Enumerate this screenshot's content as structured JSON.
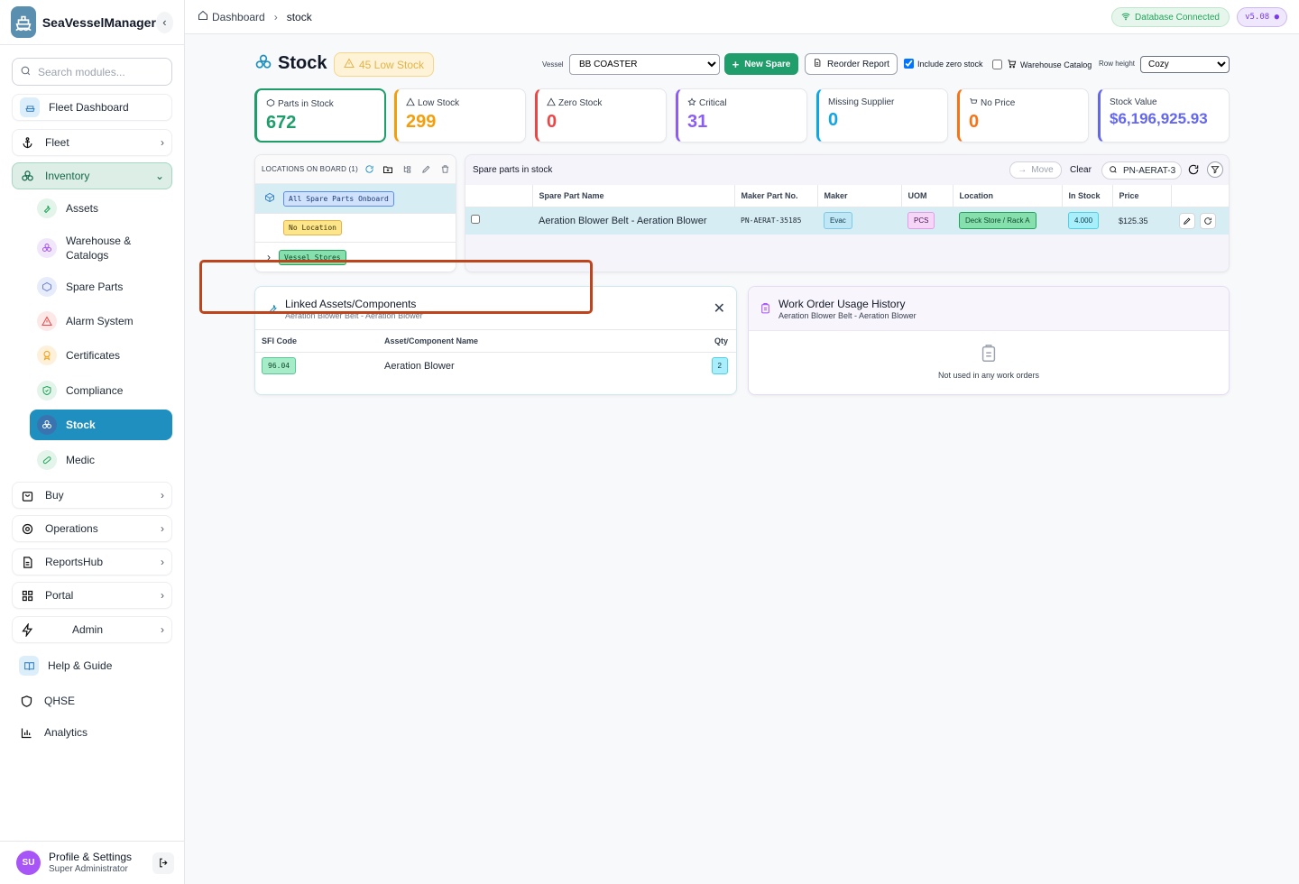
{
  "app": {
    "name": "SeaVesselManager"
  },
  "sidebar": {
    "search_placeholder": "Search modules...",
    "items": {
      "fleet_dashboard": "Fleet Dashboard",
      "fleet": "Fleet",
      "inventory": "Inventory",
      "buy": "Buy",
      "operations": "Operations",
      "reportshub": "ReportsHub",
      "portal": "Portal",
      "admin": "Admin",
      "help": "Help & Guide",
      "qhse": "QHSE",
      "analytics": "Analytics"
    },
    "inventory_sub": {
      "assets": "Assets",
      "warehouse": "Warehouse & Catalogs",
      "spare_parts": "Spare Parts",
      "alarm": "Alarm System",
      "certificates": "Certificates",
      "compliance": "Compliance",
      "stock": "Stock",
      "medic": "Medic"
    },
    "profile": {
      "initials": "SU",
      "name": "Profile & Settings",
      "role": "Super Administrator"
    }
  },
  "topbar": {
    "breadcrumb": [
      "Dashboard",
      "stock"
    ],
    "db_status": "Database Connected",
    "version": "v5.08 ●"
  },
  "header": {
    "title": "Stock",
    "low_stock_badge": "45 Low Stock",
    "vessel_label": "Vessel",
    "vessel_value": "BB COASTER",
    "new_spare": "New Spare",
    "reorder_report": "Reorder Report",
    "include_zero": "Include zero stock",
    "include_zero_checked": true,
    "warehouse_catalog": "Warehouse Catalog",
    "warehouse_catalog_checked": false,
    "row_height_label": "Row height",
    "row_height_value": "Cozy"
  },
  "stats": [
    {
      "label": "Parts in Stock",
      "value": "672",
      "color": "#1f9d6b"
    },
    {
      "label": "Low Stock",
      "value": "299",
      "color": "#f59e0b"
    },
    {
      "label": "Zero Stock",
      "value": "0",
      "color": "#ef4444"
    },
    {
      "label": "Critical",
      "value": "31",
      "color": "#8b5cf6"
    },
    {
      "label": "Missing Supplier",
      "value": "0",
      "color": "#0ea5e9"
    },
    {
      "label": "No Price",
      "value": "0",
      "color": "#f97316"
    },
    {
      "label": "Stock Value",
      "value": "$6,196,925.93",
      "color": "#6366f1"
    }
  ],
  "locations": {
    "header": "LOCATIONS ON BOARD (1)",
    "items": [
      "All Spare Parts Onboard",
      "No Location",
      "Vessel Stores"
    ]
  },
  "spares": {
    "title": "Spare parts in stock",
    "move": "Move",
    "clear": "Clear",
    "search_value": "PN-AERAT-3",
    "columns": [
      "Spare Part Name",
      "Maker Part No.",
      "Maker",
      "UOM",
      "Location",
      "In Stock",
      "Price"
    ],
    "rows": [
      {
        "name": "Aeration Blower Belt - Aeration Blower",
        "maker_part": "PN-AERAT-35185",
        "maker": "Evac",
        "uom": "PCS",
        "location": "Deck Store / Rack A",
        "in_stock": "4.000",
        "price": "$125.35"
      }
    ]
  },
  "linked": {
    "title": "Linked Assets/Components",
    "subtitle": "Aeration Blower Belt - Aeration Blower",
    "columns": [
      "SFI Code",
      "Asset/Component Name",
      "Qty"
    ],
    "rows": [
      {
        "sfi": "96.04",
        "name": "Aeration Blower",
        "qty": "2"
      }
    ]
  },
  "history": {
    "title": "Work Order Usage History",
    "subtitle": "Aeration Blower Belt - Aeration Blower",
    "empty": "Not used in any work orders"
  }
}
